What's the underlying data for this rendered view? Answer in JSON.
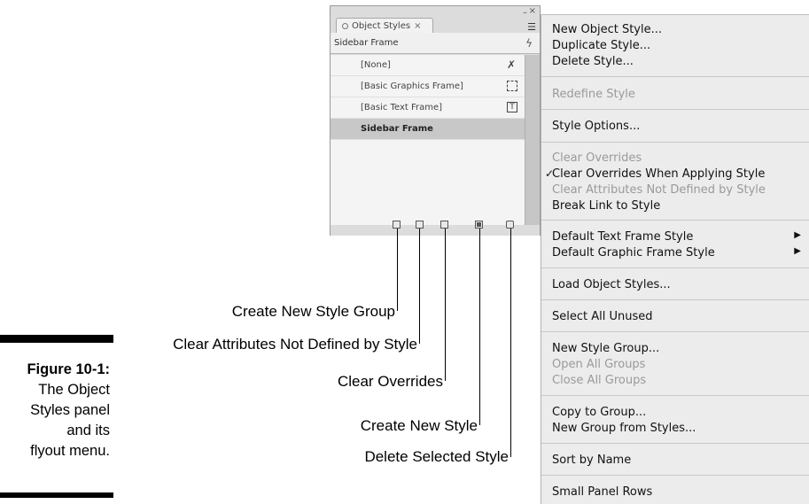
{
  "caption": {
    "figure": "Figure 10-1:",
    "lines": [
      "The Object",
      "Styles panel",
      "and its",
      "flyout menu."
    ]
  },
  "panel": {
    "tab_label": "Object Styles",
    "tab_close": "×",
    "current_style": "Sidebar Frame",
    "styles": [
      {
        "label": "[None]"
      },
      {
        "label": "[Basic Graphics Frame]"
      },
      {
        "label": "[Basic Text Frame]"
      },
      {
        "label": "Sidebar Frame",
        "selected": true
      }
    ]
  },
  "callouts": [
    "Create New Style Group",
    "Clear Attributes Not Defined by Style",
    "Clear Overrides",
    "Create New Style",
    "Delete Selected Style"
  ],
  "menu": {
    "items": [
      {
        "label": "New Object Style...",
        "enabled": true
      },
      {
        "label": "Duplicate Style...",
        "enabled": true
      },
      {
        "label": "Delete Style...",
        "enabled": true
      },
      {
        "label": "Redefine Style",
        "enabled": false
      },
      {
        "label": "Style Options...",
        "enabled": true
      },
      {
        "label": "Clear Overrides",
        "enabled": false
      },
      {
        "label": "Clear Overrides When Applying Style",
        "enabled": true,
        "checked": true
      },
      {
        "label": "Clear Attributes Not Defined by Style",
        "enabled": false
      },
      {
        "label": "Break Link to Style",
        "enabled": true
      },
      {
        "label": "Default Text Frame Style",
        "enabled": true,
        "submenu": true
      },
      {
        "label": "Default Graphic Frame Style",
        "enabled": true,
        "submenu": true
      },
      {
        "label": "Load Object Styles...",
        "enabled": true
      },
      {
        "label": "Select All Unused",
        "enabled": true
      },
      {
        "label": "New Style Group...",
        "enabled": true
      },
      {
        "label": "Open All Groups",
        "enabled": false
      },
      {
        "label": "Close All Groups",
        "enabled": false
      },
      {
        "label": "Copy to Group...",
        "enabled": true
      },
      {
        "label": "New Group from Styles...",
        "enabled": true
      },
      {
        "label": "Sort by Name",
        "enabled": true
      },
      {
        "label": "Small Panel Rows",
        "enabled": true
      }
    ]
  }
}
